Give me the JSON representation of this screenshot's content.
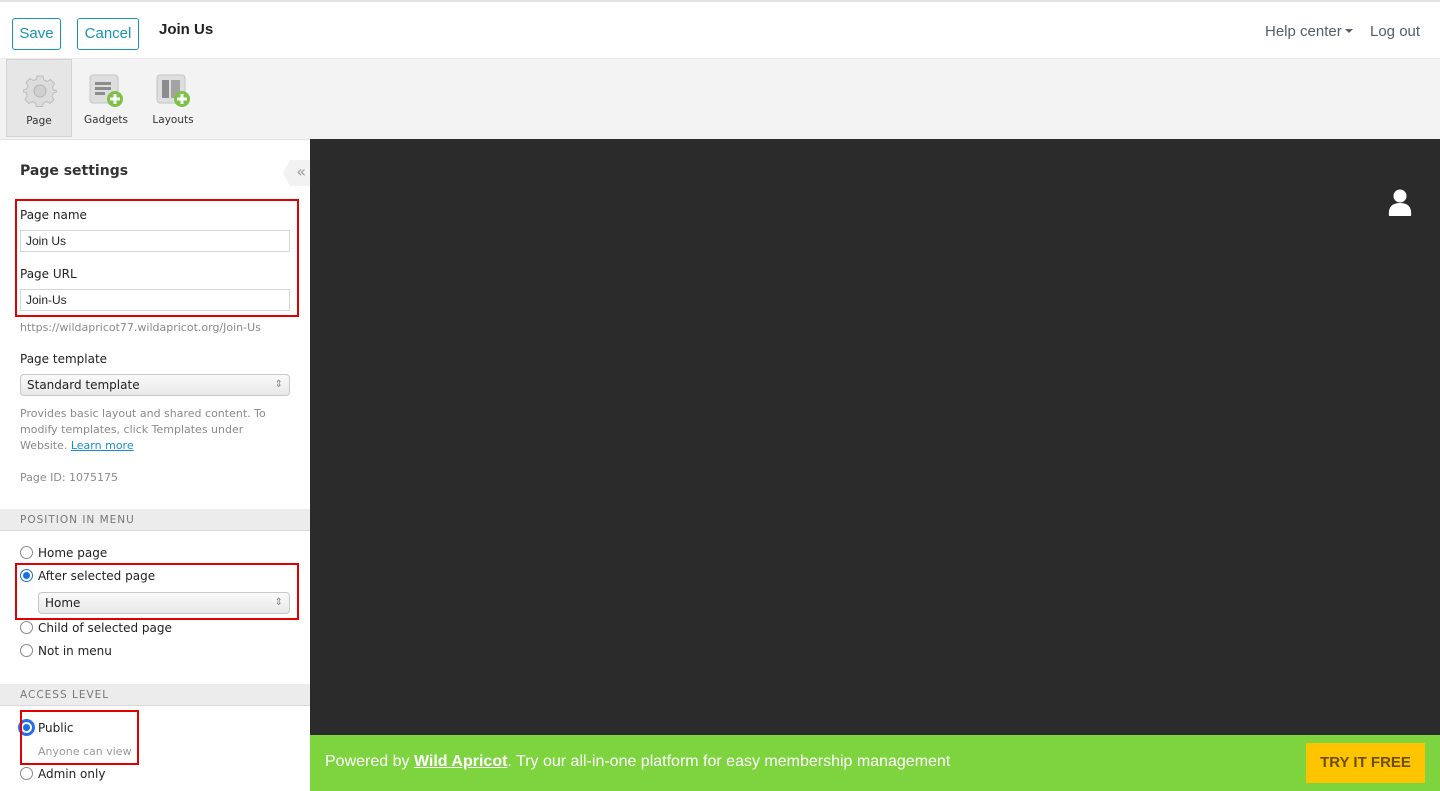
{
  "topbar": {
    "save_label": "Save",
    "cancel_label": "Cancel",
    "page_title": "Join Us",
    "help_label": "Help center",
    "logout_label": "Log out"
  },
  "toolbar": {
    "items": [
      {
        "label": "Page",
        "icon": "gear-icon",
        "active": true
      },
      {
        "label": "Gadgets",
        "icon": "add-gadget-icon",
        "active": false
      },
      {
        "label": "Layouts",
        "icon": "add-layout-icon",
        "active": false
      }
    ]
  },
  "panel": {
    "collapse_icon": "«",
    "title": "Page settings",
    "page_name_label": "Page name",
    "page_name_value": "Join Us",
    "page_url_label": "Page URL",
    "page_url_value": "Join-Us",
    "full_url": "https://wildapricot77.wildapricot.org/Join-Us",
    "template_label": "Page template",
    "template_value": "Standard template",
    "template_desc": "Provides basic layout and shared content. To modify templates, click Templates under Website.",
    "learn_more": "Learn more",
    "page_id": "Page ID: 1075175",
    "position_header": "POSITION IN MENU",
    "position_options": [
      {
        "label": "Home page",
        "selected": false
      },
      {
        "label": "After selected page",
        "selected": true
      },
      {
        "label": "Child of selected page",
        "selected": false
      },
      {
        "label": "Not in menu",
        "selected": false
      }
    ],
    "after_page_value": "Home",
    "access_header": "ACCESS LEVEL",
    "access_options": [
      {
        "label": "Public",
        "hint": "Anyone can view",
        "selected": true
      },
      {
        "label": "Admin only",
        "selected": false
      }
    ]
  },
  "promo": {
    "prefix": "Powered by ",
    "brand": "Wild Apricot",
    "suffix": ". Try our all-in-one platform for easy membership management",
    "cta": "TRY IT FREE"
  },
  "colors": {
    "accent": "#1a93b0",
    "promo_bg": "#7ed43f",
    "cta_bg": "#ffc400",
    "highlight": "#e30000"
  }
}
